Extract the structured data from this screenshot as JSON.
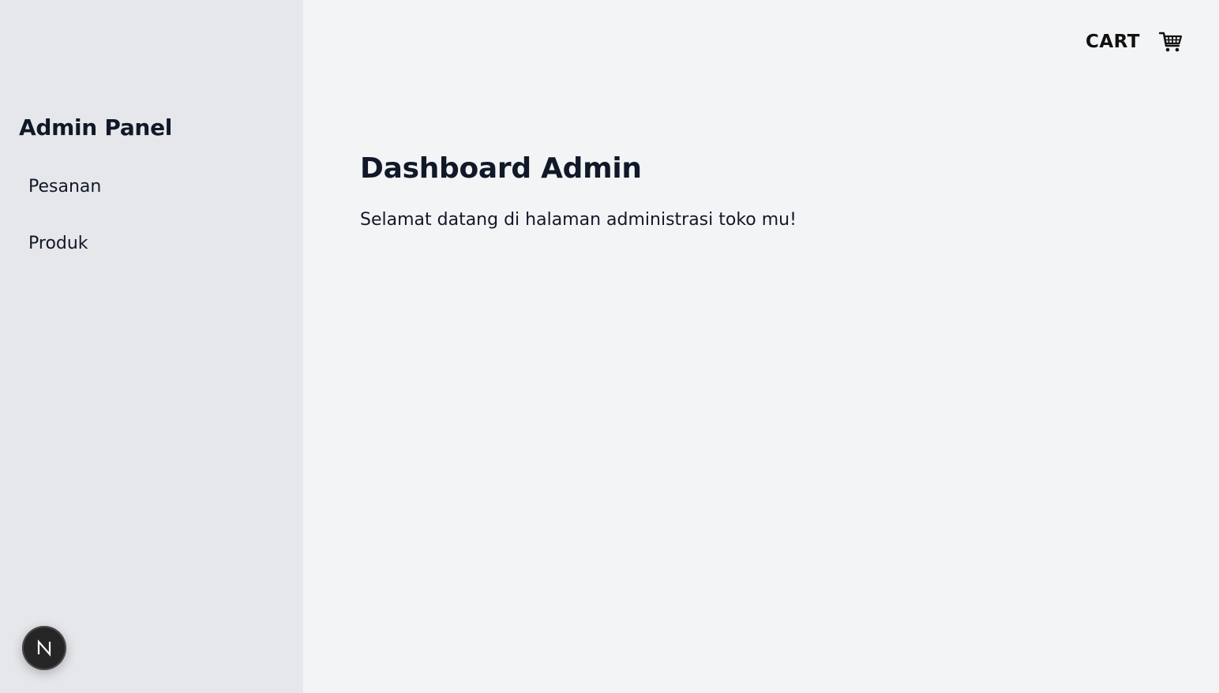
{
  "sidebar": {
    "title": "Admin Panel",
    "items": [
      {
        "label": "Pesanan"
      },
      {
        "label": "Produk"
      }
    ]
  },
  "header": {
    "cart_label": "CART",
    "cart_icon": "shopping-cart-icon"
  },
  "main": {
    "title": "Dashboard Admin",
    "subtitle": "Selamat datang di halaman administrasi toko mu!"
  },
  "dev_badge": {
    "letter": "N",
    "icon": "nextjs-logo-icon"
  },
  "colors": {
    "sidebar_bg": "#e5e7eb",
    "main_bg": "#f3f4f6",
    "text": "#111827",
    "badge_bg": "#262626"
  }
}
